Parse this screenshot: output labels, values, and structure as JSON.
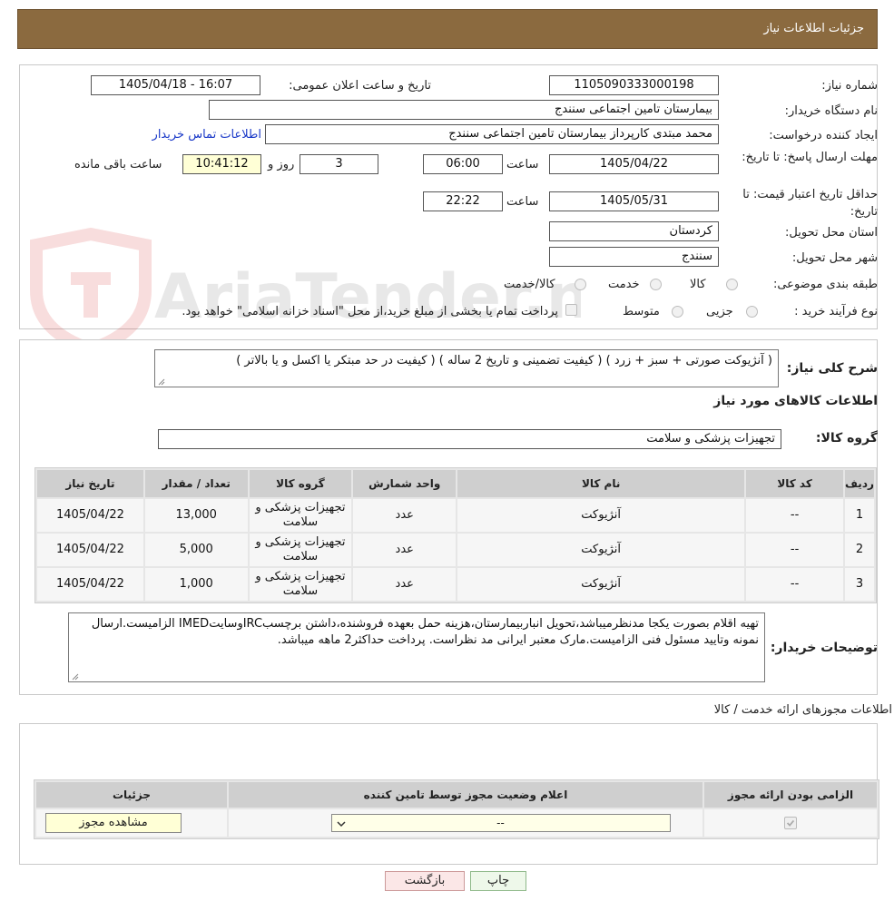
{
  "header": {
    "title": "جزئیات اطلاعات نیاز"
  },
  "need_info": {
    "need_number_label": "شماره نیاز:",
    "need_number": "1105090333000198",
    "announce_label": "تاریخ و ساعت اعلان عمومی:",
    "announce_value": "1405/04/18 - 16:07",
    "buyer_org_label": "نام دستگاه خریدار:",
    "buyer_org": "بیمارستان تامین اجتماعی سنندج",
    "creator_label": "ایجاد کننده درخواست:",
    "creator": "محمد مبتدی کارپرداز بیمارستان تامین اجتماعی سنندج",
    "contact_link": "اطلاعات تماس خریدار",
    "deadline_label": "مهلت ارسال پاسخ: تا تاریخ:",
    "deadline_date": "1405/04/22",
    "time_label": "ساعت",
    "deadline_time": "06:00",
    "days": "3",
    "days_label": "روز و",
    "remaining_time": "10:41:12",
    "remaining_label": "ساعت باقی مانده",
    "price_validity_label": "حداقل تاریخ اعتبار قیمت: تا تاریخ:",
    "price_validity_date": "1405/05/31",
    "price_validity_time": "22:22",
    "province_label": "استان محل تحویل:",
    "province": "کردستان",
    "city_label": "شهر محل تحویل:",
    "city": "سنندج",
    "category_label": "طبقه بندی موضوعی:",
    "category_options": [
      "کالا",
      "خدمت",
      "کالا/خدمت"
    ],
    "process_label": "نوع فرآیند خرید :",
    "process_options": [
      "جزیی",
      "متوسط"
    ],
    "treasury_note": "پرداخت تمام یا بخشی از مبلغ خرید،از محل \"اسناد خزانه اسلامی\" خواهد بود."
  },
  "watermark": {
    "text": "AriaTender.neT"
  },
  "summary": {
    "label": "شرح کلی نیاز:",
    "text": "( آنژیوکت صورتی + سبز + زرد ) ( کیفیت تضمینی و تاریخ 2 ساله ) ( کیفیت در حد مبتکر یا اکسل و یا بالاتر )",
    "goods_info_title": "اطلاعات کالاهای مورد نیاز",
    "goods_group_label": "گروه کالا:",
    "goods_group": "تجهیزات پزشکی و سلامت"
  },
  "items_table": {
    "headers": [
      "ردیف",
      "کد کالا",
      "نام کالا",
      "واحد شمارش",
      "گروه کالا",
      "تعداد / مقدار",
      "تاریخ نیاز"
    ],
    "rows": [
      [
        "1",
        "--",
        "آنژیوکت",
        "عدد",
        "تجهیزات پزشکی و سلامت",
        "13,000",
        "1405/04/22"
      ],
      [
        "2",
        "--",
        "آنژیوکت",
        "عدد",
        "تجهیزات پزشکی و سلامت",
        "5,000",
        "1405/04/22"
      ],
      [
        "3",
        "--",
        "آنژیوکت",
        "عدد",
        "تجهیزات پزشکی و سلامت",
        "1,000",
        "1405/04/22"
      ]
    ]
  },
  "buyer_notes": {
    "label": "توضیحات خریدار:",
    "text": "تهیه اقلام بصورت یکجا مدنظرمیباشد،تحویل انباربیمارستان،هزینه حمل بعهده فروشنده،داشتن برچسبIRCوسایتIMED الزامیست.ارسال نمونه وتایید مسئول فنی الزامیست.مارک معتبر ایرانی مد نظراست. پرداخت حداکثر2 ماهه میباشد."
  },
  "permits": {
    "title": "اطلاعات مجوزهای ارائه خدمت / کالا",
    "headers": [
      "الزامی بودن ارائه مجوز",
      "اعلام وضعیت مجوز توسط تامین کننده",
      "جزئیات"
    ],
    "select_value": "--",
    "view_button": "مشاهده مجوز"
  },
  "actions": {
    "print": "چاپ",
    "back": "بازگشت"
  }
}
